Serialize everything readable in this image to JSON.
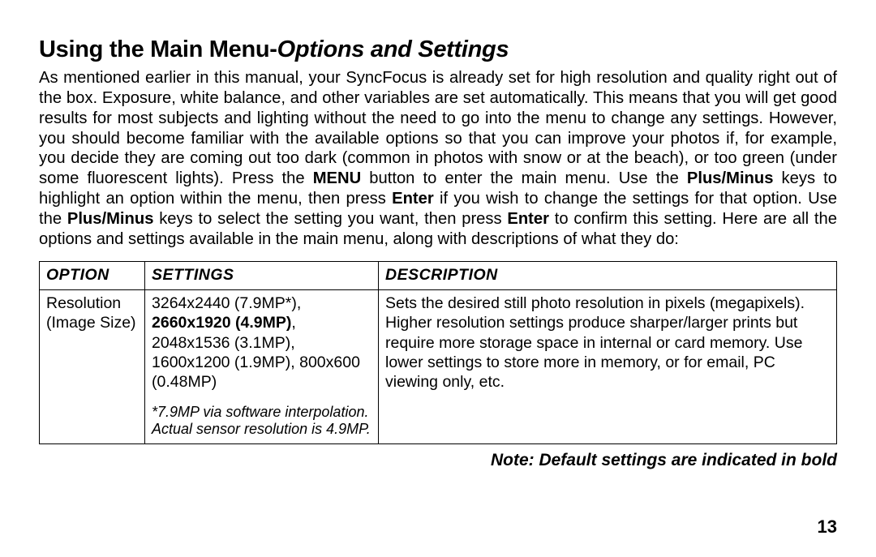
{
  "heading_main": "Using the Main Menu-",
  "heading_sub": "Options and Settings",
  "paragraph_parts": [
    "As mentioned earlier in this manual, your SyncFocus is already set for high resolution and quality right out of the box. Exposure, white balance, and other variables are set automatically.  This means that you will get good results for most subjects and lighting without the need to go into the menu to change any settings. However, you should become familiar with the available options so that you can improve your photos if, for example, you decide they are coming out too dark (common in photos with snow or at the beach), or too green (under some fluorescent lights). Press the ",
    "MENU",
    " button to enter the main menu. Use the ",
    "Plus/Minus",
    " keys to highlight an option within the menu, then press ",
    "Enter",
    " if you wish to change the settings for that option. Use the ",
    "Plus/Minus",
    " keys to select the setting you want, then press ",
    "Enter",
    " to confirm this setting. Here are all the options and settings available in the main menu, along with descriptions of what they do:"
  ],
  "table": {
    "headers": {
      "option": "OPTION",
      "settings": "SETTINGS",
      "description": "DESCRIPTION"
    },
    "row": {
      "option_line1": "Resolution",
      "option_line2": "(Image Size)",
      "settings_line1": "3264x2440 (7.9MP*),",
      "settings_bold": "2660x1920 (4.9MP)",
      "settings_after_bold": ",",
      "settings_line3": "2048x1536 (3.1MP),",
      "settings_line4": "1600x1200 (1.9MP), 800x600 (0.48MP)",
      "settings_footnote": "*7.9MP via software interpolation. Actual sensor resolution is 4.9MP.",
      "description": "Sets the desired still photo resolution in pixels (megapixels). Higher resolution settings produce sharper/larger prints but require more storage space in internal or card memory. Use lower settings to store more in memory, or for email, PC viewing only, etc."
    }
  },
  "note": "Note: Default settings are indicated in bold",
  "page_number": "13"
}
